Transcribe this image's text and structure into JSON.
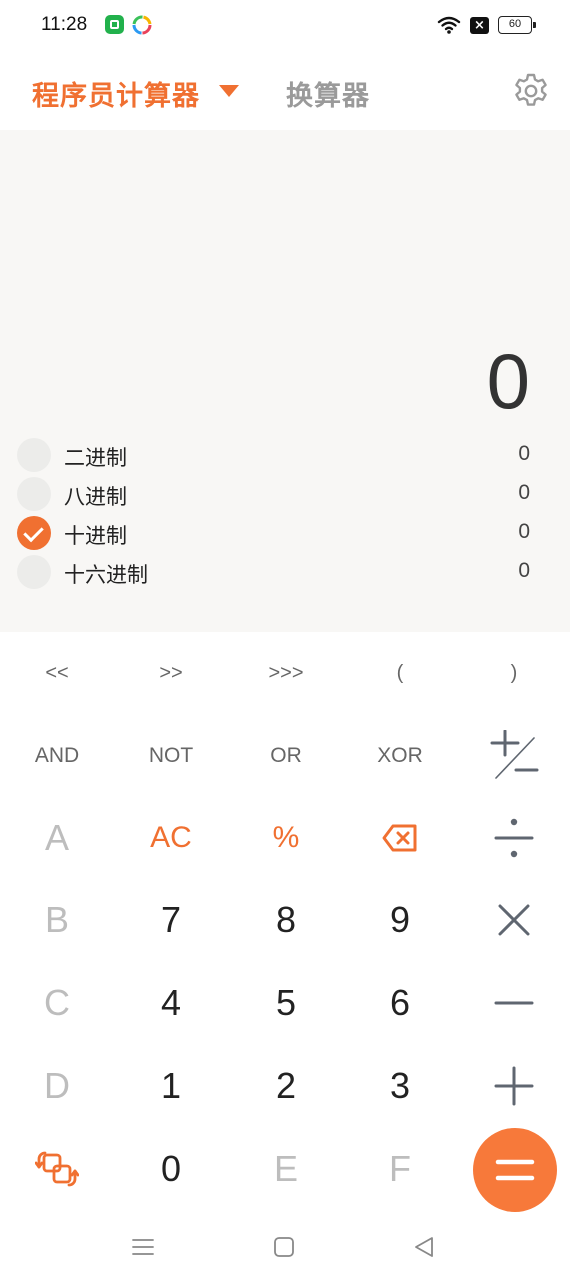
{
  "status_bar": {
    "time": "11:28",
    "battery": "60",
    "sim_label": "×"
  },
  "header": {
    "mode_title": "程序员计算器",
    "converter_tab": "换算器"
  },
  "display": {
    "result": "0",
    "bases": [
      {
        "label": "二进制",
        "value": "0",
        "checked": false
      },
      {
        "label": "八进制",
        "value": "0",
        "checked": false
      },
      {
        "label": "十进制",
        "value": "0",
        "checked": true
      },
      {
        "label": "十六进制",
        "value": "0",
        "checked": false
      }
    ]
  },
  "keypad": {
    "row1": [
      "<<",
      ">>",
      ">>>",
      "(",
      ")"
    ],
    "row2": [
      "AND",
      "NOT",
      "OR",
      "XOR"
    ],
    "row3": [
      "A",
      "AC",
      "%"
    ],
    "row4": [
      "B",
      "7",
      "8",
      "9"
    ],
    "row5": [
      "C",
      "4",
      "5",
      "6"
    ],
    "row6": [
      "D",
      "1",
      "2",
      "3"
    ],
    "row7": [
      "0",
      "E",
      "F"
    ]
  },
  "colors": {
    "accent": "#f07031",
    "display_bg": "#f8f7f5",
    "disabled_key": "#bdbdbd",
    "operator": "#5f6670"
  },
  "icons": {
    "settings": "gear-icon",
    "backspace": "backspace-icon",
    "plus_minus": "plus-minus-icon",
    "divide": "divide-icon",
    "multiply": "multiply-icon",
    "minus": "minus-icon",
    "plus": "plus-icon",
    "swap": "swap-icon",
    "equals": "equals-icon"
  }
}
